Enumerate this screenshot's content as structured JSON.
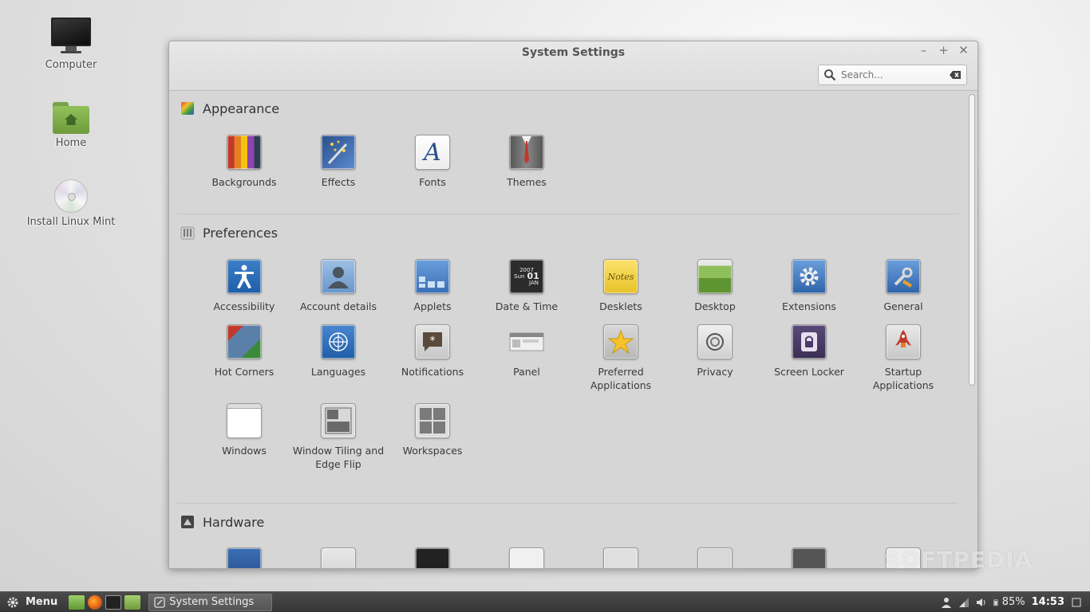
{
  "desktop": {
    "icons": [
      {
        "label": "Computer"
      },
      {
        "label": "Home"
      },
      {
        "label": "Install Linux Mint"
      }
    ]
  },
  "window": {
    "title": "System Settings",
    "controls": {
      "minimize": "–",
      "maximize": "+",
      "close": "✕"
    },
    "search": {
      "placeholder": "Search..."
    }
  },
  "sections": {
    "appearance": {
      "title": "Appearance",
      "items": [
        "Backgrounds",
        "Effects",
        "Fonts",
        "Themes"
      ]
    },
    "preferences": {
      "title": "Preferences",
      "items": [
        "Accessibility",
        "Account details",
        "Applets",
        "Date & Time",
        "Desklets",
        "Desktop",
        "Extensions",
        "General",
        "Hot Corners",
        "Languages",
        "Notifications",
        "Panel",
        "Preferred Applications",
        "Privacy",
        "Screen Locker",
        "Startup Applications",
        "Windows",
        "Window Tiling and Edge Flip",
        "Workspaces"
      ],
      "date_icon": {
        "year": "2007",
        "day": "Sun",
        "num": "01",
        "month": "JAN"
      },
      "desklet_icon_text": "Notes"
    },
    "hardware": {
      "title": "Hardware"
    }
  },
  "taskbar": {
    "menu_label": "Menu",
    "task_label": "System Settings",
    "battery": "85%",
    "clock": "14:53"
  },
  "watermark": "SOFTPEDIA",
  "colors": {
    "accent_blue": "#4a78b8",
    "taskbar": "#3e3e3e",
    "mint_green": "#87b158"
  }
}
